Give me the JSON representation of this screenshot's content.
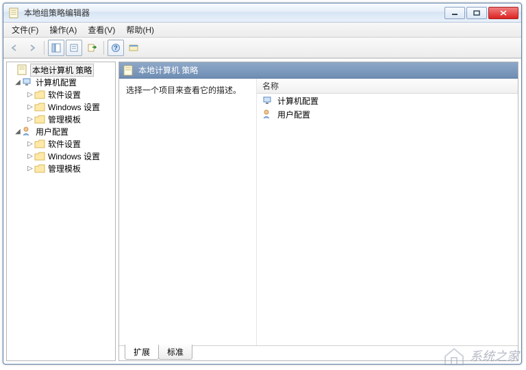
{
  "window": {
    "title": "本地组策略编辑器"
  },
  "menu": {
    "file": "文件(F)",
    "action": "操作(A)",
    "view": "查看(V)",
    "help": "帮助(H)"
  },
  "tree": {
    "root": "本地计算机 策略",
    "computer": {
      "label": "计算机配置",
      "children": [
        "软件设置",
        "Windows 设置",
        "管理模板"
      ]
    },
    "user": {
      "label": "用户配置",
      "children": [
        "软件设置",
        "Windows 设置",
        "管理模板"
      ]
    }
  },
  "detail": {
    "header": "本地计算机 策略",
    "description": "选择一个项目来查看它的描述。",
    "column_name": "名称",
    "items": [
      "计算机配置",
      "用户配置"
    ]
  },
  "tabs": {
    "extended": "扩展",
    "standard": "标准"
  },
  "watermark": "系统之家"
}
